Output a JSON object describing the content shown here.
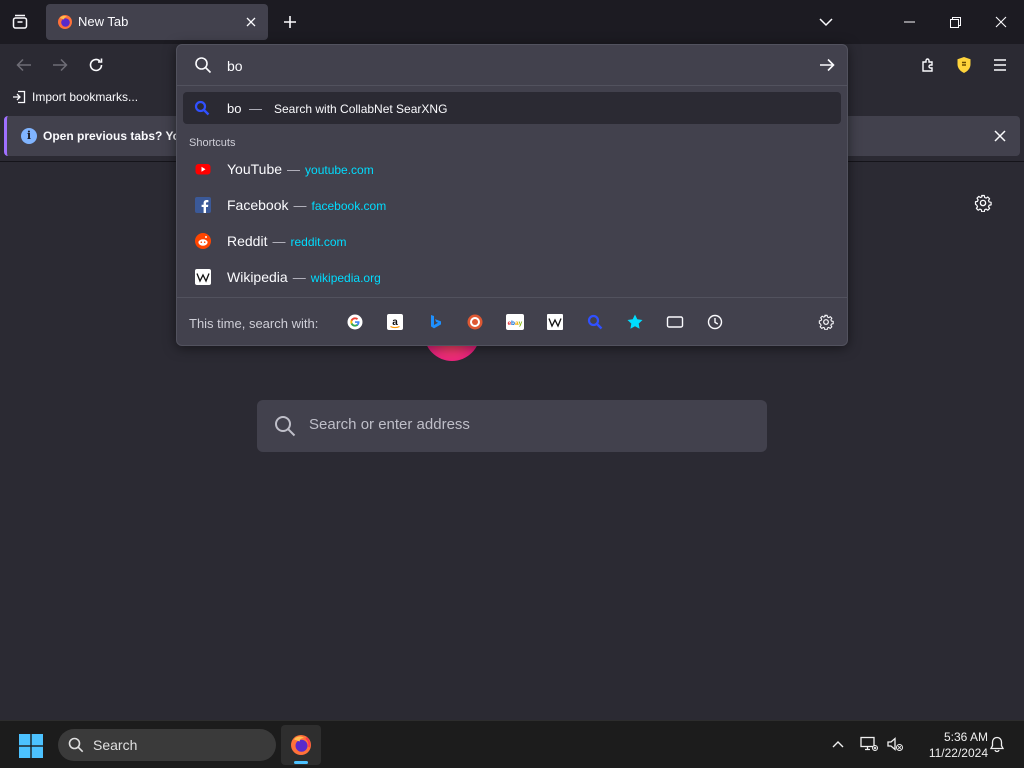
{
  "browser": {
    "tab": {
      "title": "New Tab",
      "favicon": "firefox-icon"
    },
    "bookmarks": {
      "import_label": "Import bookmarks..."
    },
    "notification": {
      "text": "Open previous tabs? You c"
    }
  },
  "urlbar": {
    "value": "bo",
    "heuristic": {
      "query": "bo",
      "separator": "—",
      "action": "Search with CollabNet SearXNG"
    },
    "shortcuts_label": "Shortcuts",
    "shortcuts": [
      {
        "title": "YouTube",
        "url": "youtube.com",
        "icon": "youtube-icon"
      },
      {
        "title": "Facebook",
        "url": "facebook.com",
        "icon": "facebook-icon"
      },
      {
        "title": "Reddit",
        "url": "reddit.com",
        "icon": "reddit-icon"
      },
      {
        "title": "Wikipedia",
        "url": "wikipedia.org",
        "icon": "wikipedia-icon"
      }
    ],
    "one_off_label": "This time, search with:",
    "one_off_engines": [
      "google",
      "amazon",
      "bing",
      "duckduckgo",
      "ebay",
      "wikipedia",
      "searxng",
      "bookmarks",
      "tabs",
      "history"
    ]
  },
  "newtab": {
    "search_placeholder": "Search or enter address"
  },
  "taskbar": {
    "search_label": "Search",
    "time": "5:36 AM",
    "date": "11/22/2024"
  },
  "colors": {
    "accent_link": "#00ddff",
    "background": "#2b2a33",
    "panel": "#42414d",
    "titlebar": "#1c1b22"
  }
}
